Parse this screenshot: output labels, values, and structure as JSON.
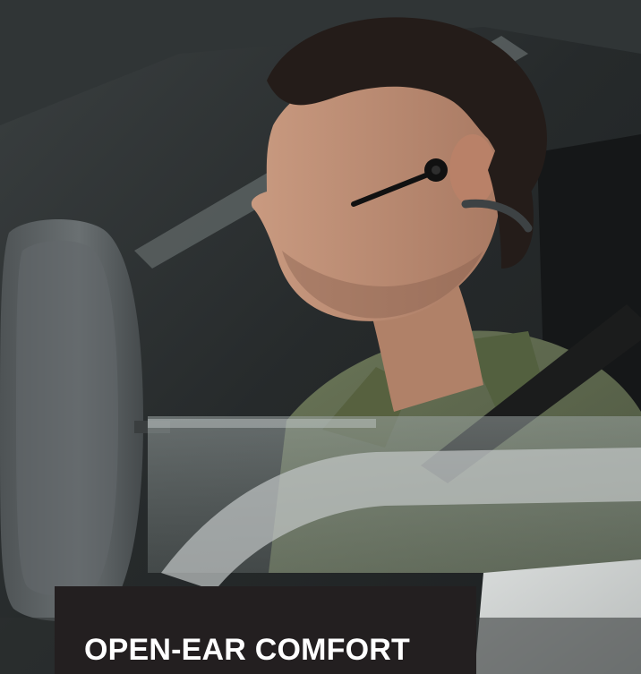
{
  "hero": {
    "caption_title": "OPEN-EAR COMFORT"
  },
  "colors": {
    "caption_background": "#231f20",
    "caption_text": "#ffffff",
    "shirt": "#5f6a4f",
    "skin": "#b98c74",
    "hair": "#241c19",
    "headset": "#111111"
  },
  "icons": [
    "headset-icon"
  ]
}
